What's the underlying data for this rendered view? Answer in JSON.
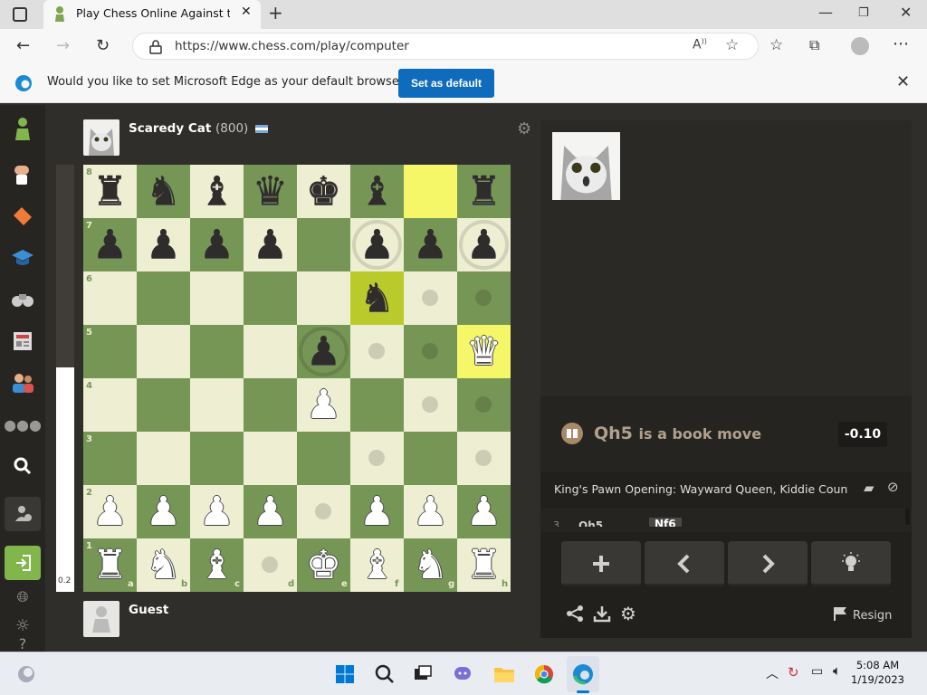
{
  "browser": {
    "tab_title": "Play Chess Online Against the Computer",
    "url": "https://www.chess.com/play/computer",
    "infobar_message": "Would you like to set Microsoft Edge as your default browser?",
    "set_default_label": "Set as default"
  },
  "game": {
    "opponent": {
      "name": "Scaredy Cat",
      "rating": "(800)"
    },
    "player": {
      "name": "Guest"
    },
    "eval_bar_value": "0.2",
    "eval_bar_white_fraction": 0.525,
    "ranks": [
      "8",
      "7",
      "6",
      "5",
      "4",
      "3",
      "2",
      "1"
    ],
    "files": [
      "a",
      "b",
      "c",
      "d",
      "e",
      "f",
      "g",
      "h"
    ],
    "board_position": [
      [
        "br",
        "bn",
        "bb",
        "bq",
        "bk",
        "bb",
        "",
        "br"
      ],
      [
        "bp",
        "bp",
        "bp",
        "bp",
        "",
        "bp",
        "bp",
        "bp"
      ],
      [
        "",
        "",
        "",
        "",
        "",
        "bn",
        "",
        ""
      ],
      [
        "",
        "",
        "",
        "",
        "bp",
        "",
        "",
        "wq"
      ],
      [
        "",
        "",
        "",
        "",
        "wp",
        "",
        "",
        ""
      ],
      [
        "",
        "",
        "",
        "",
        "",
        "",
        "",
        ""
      ],
      [
        "wp",
        "wp",
        "wp",
        "wp",
        "",
        "wp",
        "wp",
        "wp"
      ],
      [
        "wr",
        "wn",
        "wb",
        "",
        "wk",
        "wb",
        "wn",
        "wr"
      ]
    ],
    "highlighted_squares": [
      "g8",
      "f6",
      "h5"
    ]
  },
  "panel": {
    "book_move": "Qh5",
    "book_text": "is a book move",
    "evaluation": "-0.10",
    "opening_name": "King's Pawn Opening: Wayward Queen, Kiddie Countergambit",
    "move_list_partial": [
      "3.",
      "Qh5",
      "Nf6"
    ],
    "controls": [
      "plus-icon",
      "chevron-left-icon",
      "chevron-right-icon",
      "lightbulb-icon"
    ],
    "resign_label": "Resign"
  },
  "taskbar": {
    "time": "5:08 AM",
    "date": "1/19/2023"
  },
  "colors": {
    "light_square": "#eeeed2",
    "dark_square": "#769656",
    "highlight": "#f6f669",
    "accent_button": "#0f6cbd",
    "book_move": "#b0a18e"
  }
}
